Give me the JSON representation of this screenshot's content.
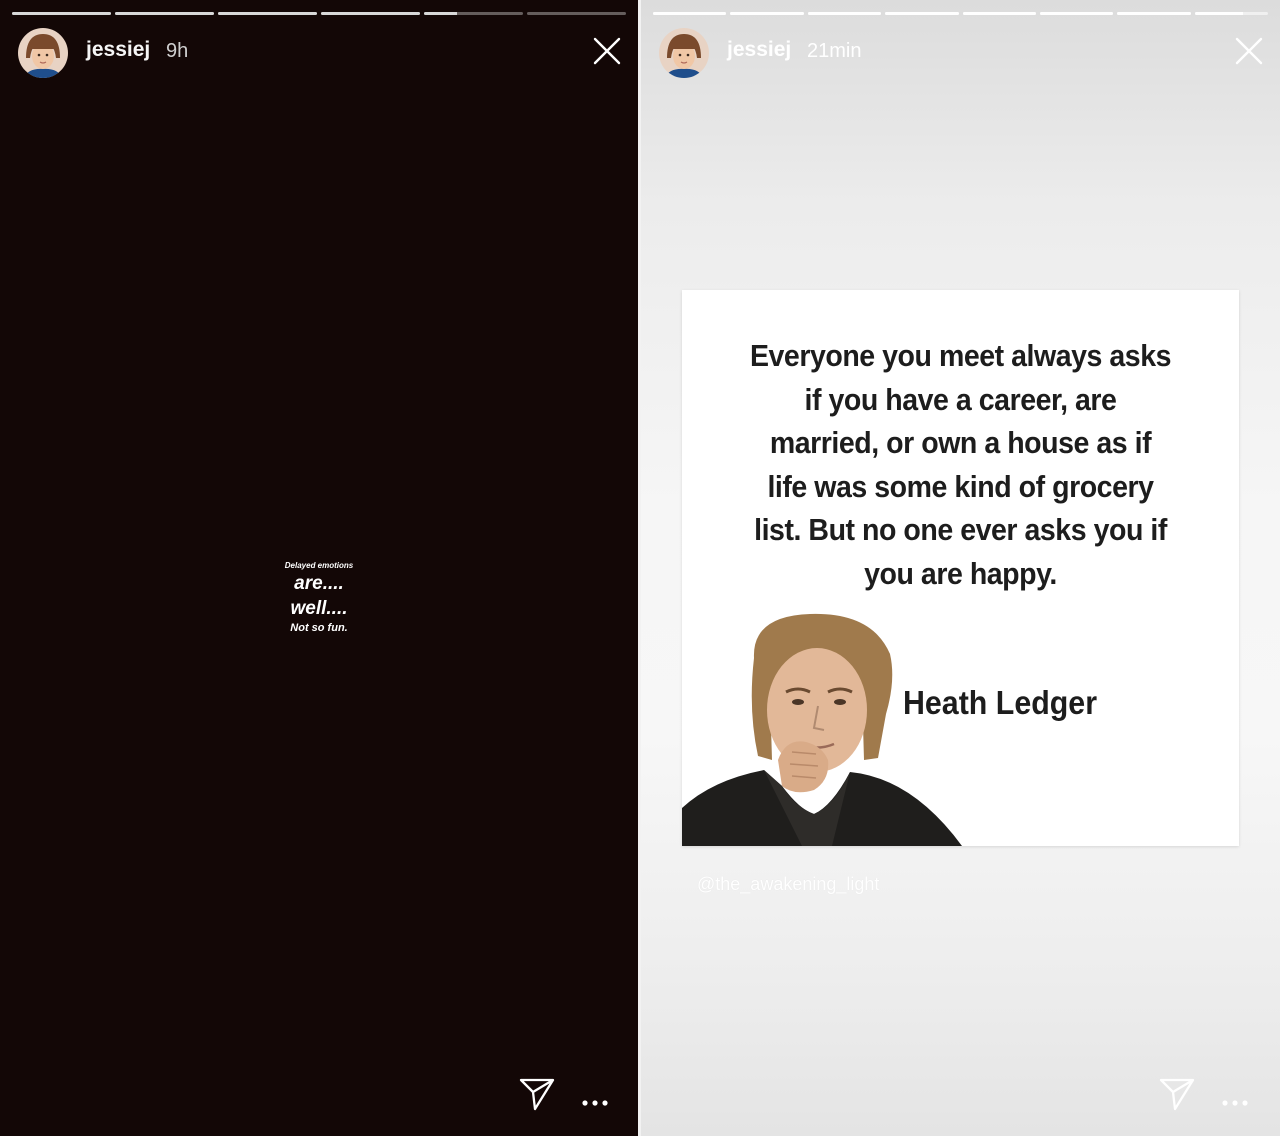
{
  "left_story": {
    "username": "jessiej",
    "time_ago": "9h",
    "progress": [
      1,
      1,
      1,
      1,
      0.33,
      0
    ],
    "text_lines": [
      "Delayed emotions",
      "are....",
      "well....",
      "Not so fun."
    ],
    "background_color": "#130706",
    "icons": {
      "close": "close-icon",
      "send": "send-icon",
      "more": "more-options-icon"
    }
  },
  "right_story": {
    "username": "jessiej",
    "time_ago": "21min",
    "progress": [
      1,
      1,
      1,
      1,
      1,
      1,
      1,
      0.66
    ],
    "quote": "Everyone you meet always asks if you have a career, are married, or own a house as if life was some kind of grocery list. But no one ever asks you if you are happy.",
    "quote_lines": [
      "Everyone you meet always asks",
      "if you have a career, are",
      "married, or own a house as if",
      "life was some kind of grocery",
      "list. But no one ever asks you if",
      "you are happy."
    ],
    "author": "Heath Ledger",
    "credit": "@the_awakening_light",
    "icons": {
      "close": "close-icon",
      "send": "send-icon",
      "more": "more-options-icon"
    }
  }
}
